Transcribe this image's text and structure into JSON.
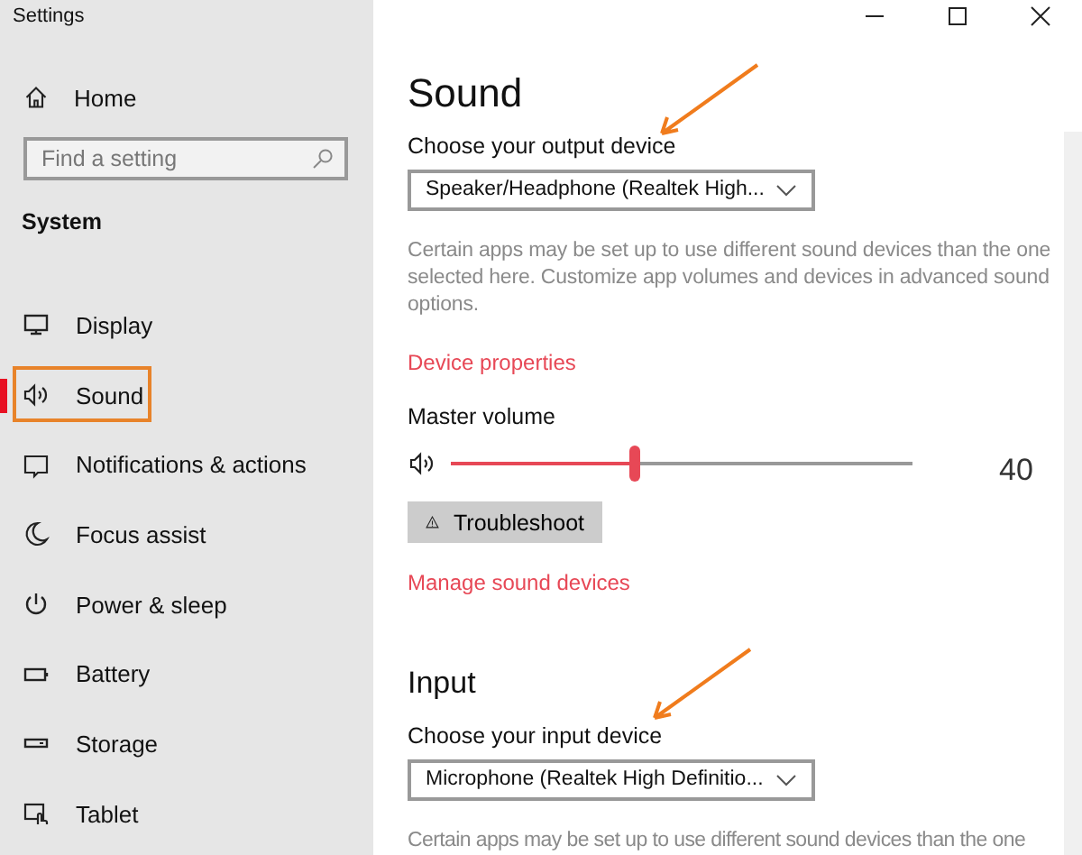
{
  "window": {
    "title": "Settings"
  },
  "sidebar": {
    "home": "Home",
    "search": {
      "placeholder": "Find a setting"
    },
    "section": "System",
    "items": [
      {
        "label": "Display",
        "kind": "display",
        "selected": false,
        "annotated": false
      },
      {
        "label": "Sound",
        "kind": "sound",
        "selected": true,
        "annotated": true
      },
      {
        "label": "Notifications & actions",
        "kind": "notifications",
        "selected": false,
        "annotated": false
      },
      {
        "label": "Focus assist",
        "kind": "focus",
        "selected": false,
        "annotated": false
      },
      {
        "label": "Power & sleep",
        "kind": "power",
        "selected": false,
        "annotated": false
      },
      {
        "label": "Battery",
        "kind": "battery",
        "selected": false,
        "annotated": false
      },
      {
        "label": "Storage",
        "kind": "storage",
        "selected": false,
        "annotated": false
      },
      {
        "label": "Tablet",
        "kind": "tablet",
        "selected": false,
        "annotated": false
      }
    ]
  },
  "main": {
    "title": "Sound",
    "output": {
      "label": "Choose your output device",
      "device": "Speaker/Headphone (Realtek High...",
      "description": "Certain apps may be set up to use different sound devices than the one selected here. Customize app volumes and devices in advanced sound options.",
      "link": "Device properties"
    },
    "volume": {
      "label": "Master volume",
      "level": 0.4,
      "reading": "40"
    },
    "troubleshoot": "Troubleshoot",
    "manage_link": "Manage sound devices",
    "input": {
      "heading": "Input",
      "label": "Choose your input device",
      "device": "Microphone (Realtek High Definitio...",
      "description": "Certain apps may be set up to use different sound devices than the one"
    }
  }
}
